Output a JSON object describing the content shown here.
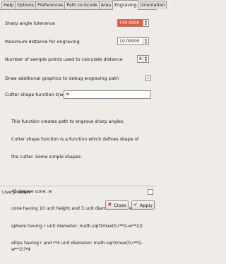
{
  "tabs": [
    "Help",
    "Options",
    "Preferences",
    "Path to Gcode",
    "Area",
    "Engraving",
    "Orientation"
  ],
  "active_tab": "Engraving",
  "fields": {
    "sharp_angle": {
      "label": "Sharp angle tolerance",
      "value": "140.0000"
    },
    "max_distance": {
      "label": "Maximum distance for engraving",
      "value": "10.00000"
    },
    "sample_points": {
      "label": "Number of sample points used to calculate distance",
      "value": "8"
    },
    "draw_debug": {
      "label": "Draw additional graphics to debug engraving path",
      "checked": true
    },
    "cutter_shape": {
      "label": "Cutter shape function z(w)=",
      "value": "w"
    }
  },
  "description": {
    "intro": [
      "This function creates path to engrave sharp angles.",
      "Cutter shape function is a function which defines shape of",
      "the cutter. Some simple shapes:"
    ],
    "examples": [
      "45 degree cone: w",
      "cone having 10 unit height and 3 unit diameter: 10/3 w",
      "sphere having r unit diameter: math.sqrt(max(0,r**2-w**2))",
      "ellips having r and r*4 unit diameter: math.sqrt(max(0,r**2-w**2))*4"
    ]
  },
  "live_preview": {
    "label": "Live preview",
    "checked": false
  },
  "buttons": {
    "close": "Close",
    "apply": "Apply"
  },
  "colors": {
    "highlight": "#e85b3c",
    "check": "#c24a14"
  }
}
